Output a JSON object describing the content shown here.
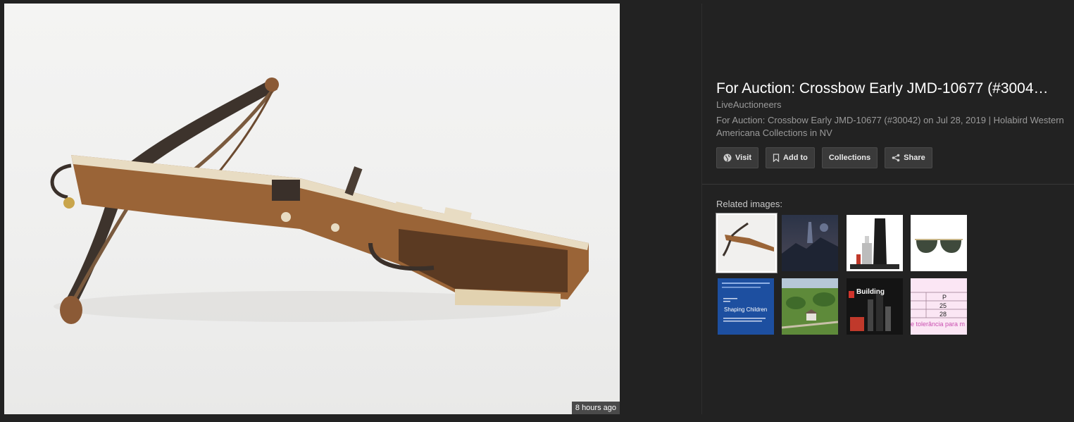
{
  "viewer": {
    "image_age": "8 hours ago"
  },
  "info": {
    "title": "For Auction: Crossbow Early JMD-10677 (#3004…",
    "source": "LiveAuctioneers",
    "description": "For Auction: Crossbow Early JMD-10677 (#30042) on Jul 28, 2019 | Holabird Western Americana Collections in NV"
  },
  "actions": {
    "visit_label": "Visit",
    "add_to_label": "Add to",
    "collections_label": "Collections",
    "share_label": "Share"
  },
  "related": {
    "label": "Related images:",
    "thumb_texts": {
      "book_title": "Shaping Children",
      "lego_label": "Building",
      "table_header": "P",
      "table_row1": "25",
      "table_row2": "28",
      "table_footer": "e tolerância para m"
    }
  },
  "icons": {
    "visit": "globe-icon",
    "add_to": "bookmark-icon",
    "share": "share-icon"
  },
  "colors": {
    "background": "#222222",
    "title": "#ffffff",
    "secondary_text": "#9a9a9a",
    "button_bg": "#3a3a3a"
  }
}
